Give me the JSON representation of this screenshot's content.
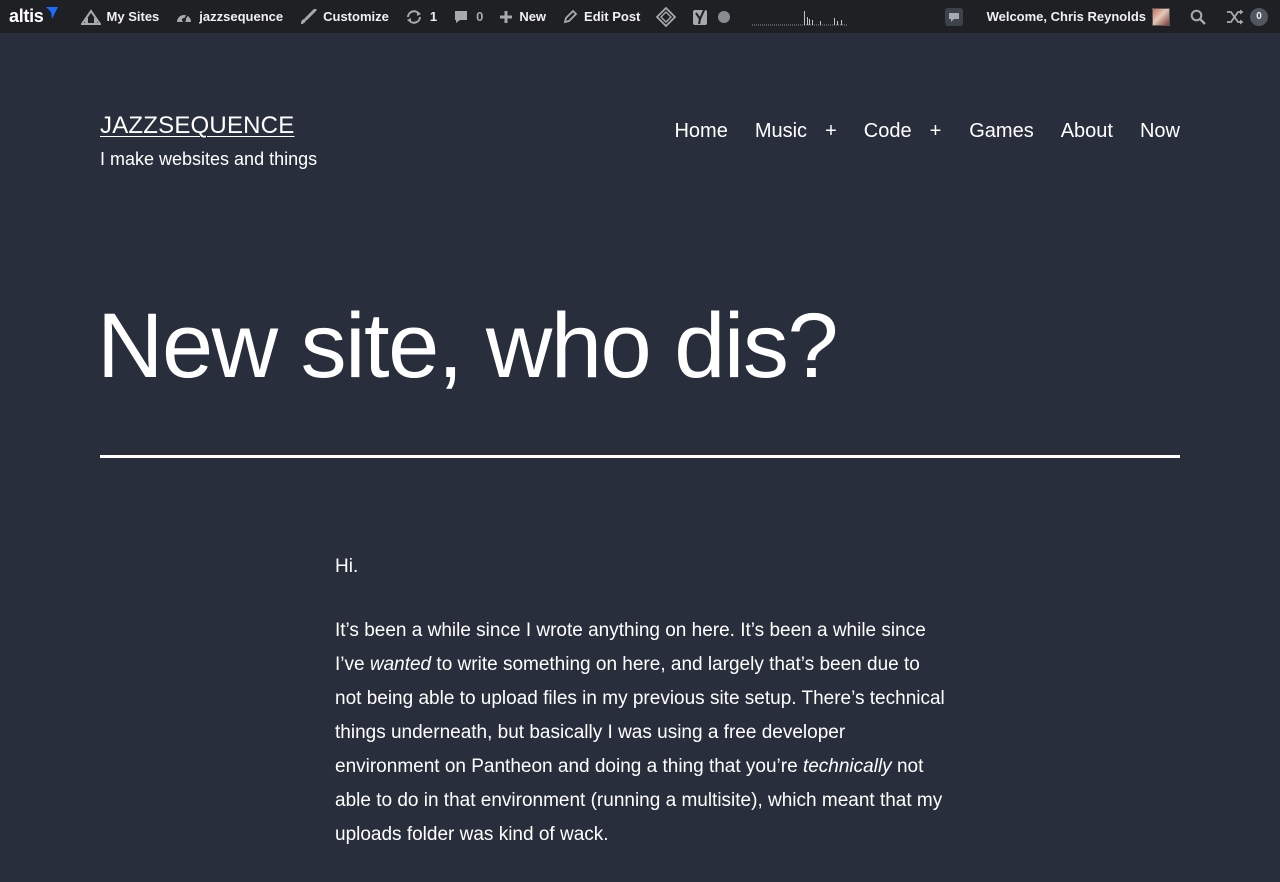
{
  "adminbar": {
    "logo": "altis",
    "my_sites": "My Sites",
    "site_name": "jazzsequence",
    "customize": "Customize",
    "updates_count": "1",
    "comments_count": "0",
    "new": "New",
    "edit_post": "Edit Post",
    "welcome": "Welcome, Chris Reynolds",
    "notifications_count": "0"
  },
  "header": {
    "site_title": "JAZZSEQUENCE",
    "tagline": "I make websites and things"
  },
  "nav": {
    "home": "Home",
    "music": "Music",
    "code": "Code",
    "games": "Games",
    "about": "About",
    "now": "Now",
    "submenu_toggle": "+"
  },
  "post": {
    "title": "New site, who dis?",
    "p1": "Hi.",
    "p2_a": "It’s been a while since I wrote anything on here. It’s been a while since I’ve ",
    "p2_em1": "wanted",
    "p2_b": " to write something on here, and largely that’s been due to not being able to upload files in my previous site setup. There’s technical things underneath, but basically I was using a free developer environment on Pantheon and doing a thing that you’re ",
    "p2_em2": "technically",
    "p2_c": " not able to do in that environment (running a multisite), which meant that my uploads folder was kind of wack."
  },
  "colors": {
    "background": "#282e3b",
    "adminbar": "#1e2024",
    "text": "#ffffff",
    "logo_accent": "#1b6bff"
  }
}
